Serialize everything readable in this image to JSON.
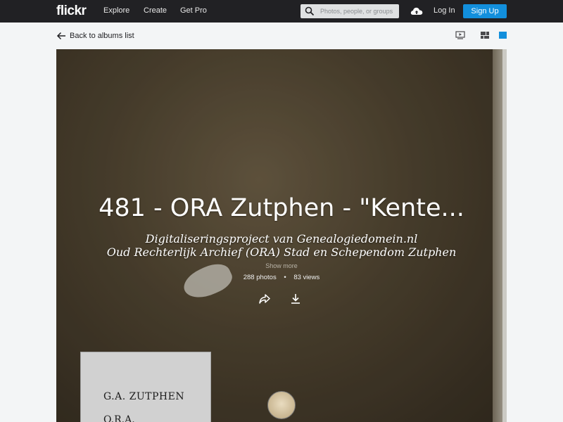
{
  "nav": {
    "logo": "flickr",
    "links": [
      "Explore",
      "Create",
      "Get Pro"
    ],
    "search_placeholder": "Photos, people, or groups",
    "login": "Log In",
    "signup": "Sign Up"
  },
  "subbar": {
    "back_label": "Back to albums list",
    "icons": [
      "slideshow-icon",
      "grid-layout-icon",
      "single-view-icon"
    ]
  },
  "album": {
    "title": "481 - ORA Zutphen - \"Kente...",
    "description_lines": [
      "Digitaliseringsproject van Genealogiedomein.nl",
      "Oud Rechterlijk Archief (ORA) Stad en Schependom Zutphen"
    ],
    "show_more": "Show more",
    "photos": "288 photos",
    "separator": "•",
    "views": "83 views",
    "cover_label_line1": "G.A. ZUTPHEN",
    "cover_label_line2": "O.R.A."
  },
  "colors": {
    "nav_bg": "#212124",
    "accent": "#128fdc",
    "page_bg": "#f3f5f6"
  }
}
